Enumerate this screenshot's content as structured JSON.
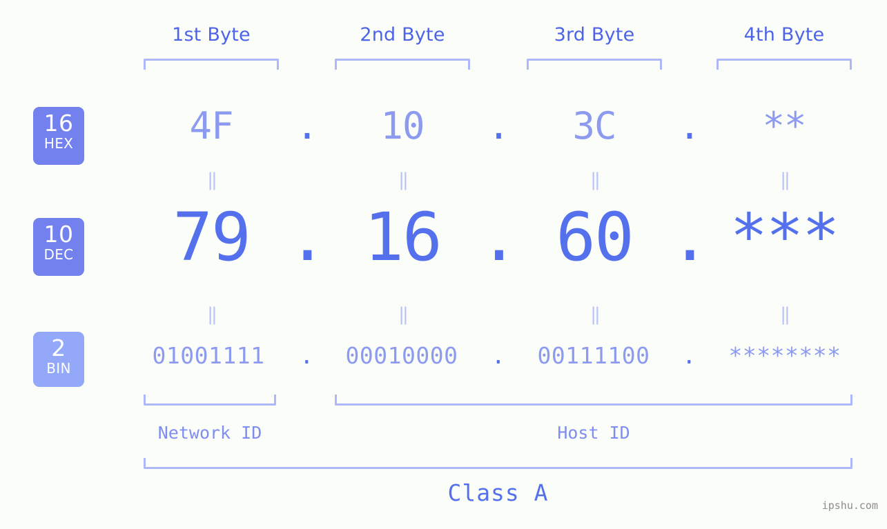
{
  "header": {
    "byte_labels": [
      {
        "label": "1st Byte"
      },
      {
        "label": "2nd Byte"
      },
      {
        "label": "3rd Byte"
      },
      {
        "label": "4th Byte"
      }
    ]
  },
  "badges": [
    {
      "num": "16",
      "system": "HEX",
      "color": "#7281ee"
    },
    {
      "num": "10",
      "system": "DEC",
      "color": "#7281ee"
    },
    {
      "num": "2",
      "system": "BIN",
      "color": "#93a8f9"
    }
  ],
  "rows": {
    "hex": {
      "name": "hexadecimal",
      "values": [
        "4F",
        "10",
        "3C",
        "**"
      ],
      "separator": "."
    },
    "dec": {
      "name": "decimal",
      "values": [
        "79",
        "16",
        "60",
        "***"
      ],
      "separator": "."
    },
    "bin": {
      "name": "binary",
      "values": [
        "01001111",
        "00010000",
        "00111100",
        "********"
      ],
      "separator": "."
    }
  },
  "equals_marks": {
    "glyph": "||",
    "rows": [
      [
        "||",
        "||",
        "||",
        "||"
      ],
      [
        "||",
        "||",
        "||",
        "||"
      ]
    ]
  },
  "sections": [
    {
      "label": "Network ID"
    },
    {
      "label": "Host ID"
    }
  ],
  "class": {
    "label": "Class A"
  },
  "watermark": {
    "text": "ipshu.com"
  },
  "colors": {
    "background": "#fbfdf8",
    "accent_strong": "#5470ed",
    "accent_medium": "#7281ee",
    "accent_light": "#8c9af0",
    "bracket": "#aeb8f8",
    "equals": "#b9c3f8",
    "badge_light": "#93a8f9",
    "watermark": "#8d8d8d"
  }
}
